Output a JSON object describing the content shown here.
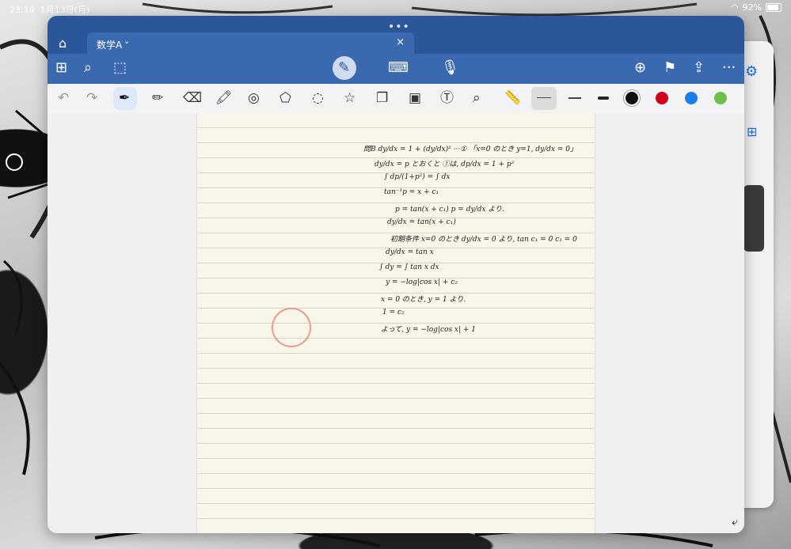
{
  "status_bar": {
    "time": "23:19",
    "date": "1月13日(月)",
    "wifi_icon": "wifi-icon",
    "battery": "92%"
  },
  "window": {
    "grip": "•••",
    "tab": {
      "title": "数学A",
      "close": "×"
    },
    "toolbar": {
      "icons": [
        "grid-icon",
        "search-icon",
        "lasso-select-icon",
        "pen-mode-icon",
        "keyboard-icon",
        "microphone-icon",
        "add-page-icon",
        "bookmark-icon",
        "share-icon",
        "more-icon"
      ],
      "more": "···"
    },
    "drawbar": {
      "tools": [
        "undo",
        "redo",
        "pen",
        "pencil",
        "eraser",
        "highlighter",
        "shape",
        "shape-recognition",
        "lasso",
        "favorites",
        "sticker",
        "image",
        "textbox",
        "image-search",
        "ruler"
      ],
      "colors": {
        "black": "#111111",
        "red": "#d0021b",
        "blue": "#1a7fe8",
        "green": "#6cc04a"
      }
    }
  },
  "notes": {
    "lines": [
      "問B  dy/dx = 1 + (dy/dx)² ···①   「x=0 のとき y=1, dy/dx = 0」",
      "dy/dx = p とおくと  ①は, dp/dx = 1 + p²",
      "∫ dp/(1+p²) = ∫ dx",
      "tan⁻¹p = x + c₁",
      "p = tan(x + c₁)        p = dy/dx より.",
      "dy/dx = tan(x + c₁)",
      "初期条件 x=0 のとき dy/dx = 0 より,  tan c₁ = 0     c₁ = 0",
      "dy/dx = tan x",
      "∫ dy = ∫ tan x dx",
      "y = −log|cos x| + c₂",
      "x = 0 のとき, y = 1 より.",
      "1 = c₂",
      "よって,  y = −log|cos x| + 1"
    ]
  }
}
